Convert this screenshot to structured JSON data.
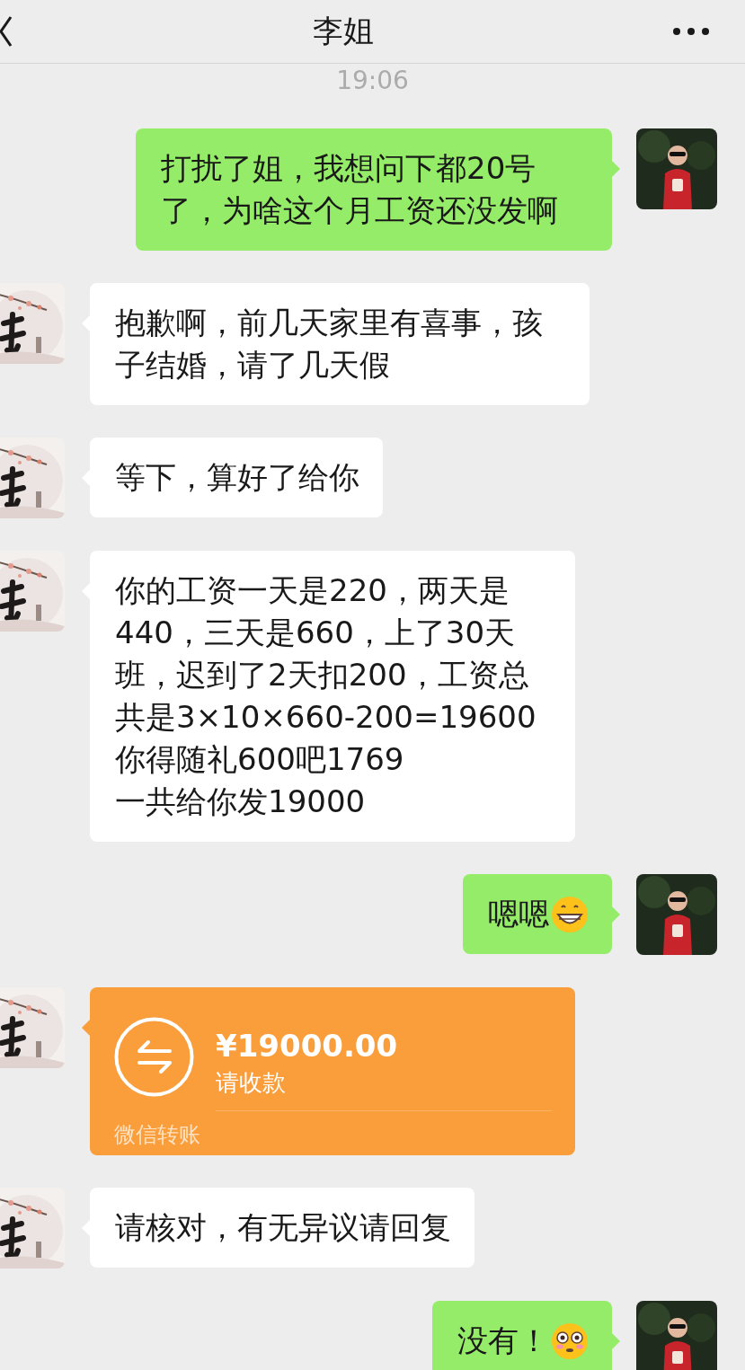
{
  "header": {
    "title": "李姐"
  },
  "time": "19:06",
  "messages": [
    {
      "kind": "text",
      "outgoing": true,
      "text": "打扰了姐，我想问下都20号了，为啥这个月工资还没发啊"
    },
    {
      "kind": "text",
      "outgoing": false,
      "text": "抱歉啊，前几天家里有喜事，孩子结婚，请了几天假"
    },
    {
      "kind": "text",
      "outgoing": false,
      "text": "等下，算好了给你"
    },
    {
      "kind": "text",
      "outgoing": false,
      "text": "你的工资一天是220，两天是440，三天是660，上了30天班，迟到了2天扣200，工资总共是3×10×660-200=19600\n你得随礼600吧1769\n一共给你发19000"
    },
    {
      "kind": "text",
      "outgoing": true,
      "text": "嗯嗯",
      "emoji": {
        "kind": "grin"
      }
    },
    {
      "kind": "transfer",
      "outgoing": false,
      "amount": "¥19000.00",
      "note": "请收款",
      "footer": "微信转账"
    },
    {
      "kind": "text",
      "outgoing": false,
      "text": "请核对，有无异议请回复"
    },
    {
      "kind": "text",
      "outgoing": true,
      "text": "没有！",
      "emoji": {
        "kind": "flushed"
      }
    }
  ]
}
